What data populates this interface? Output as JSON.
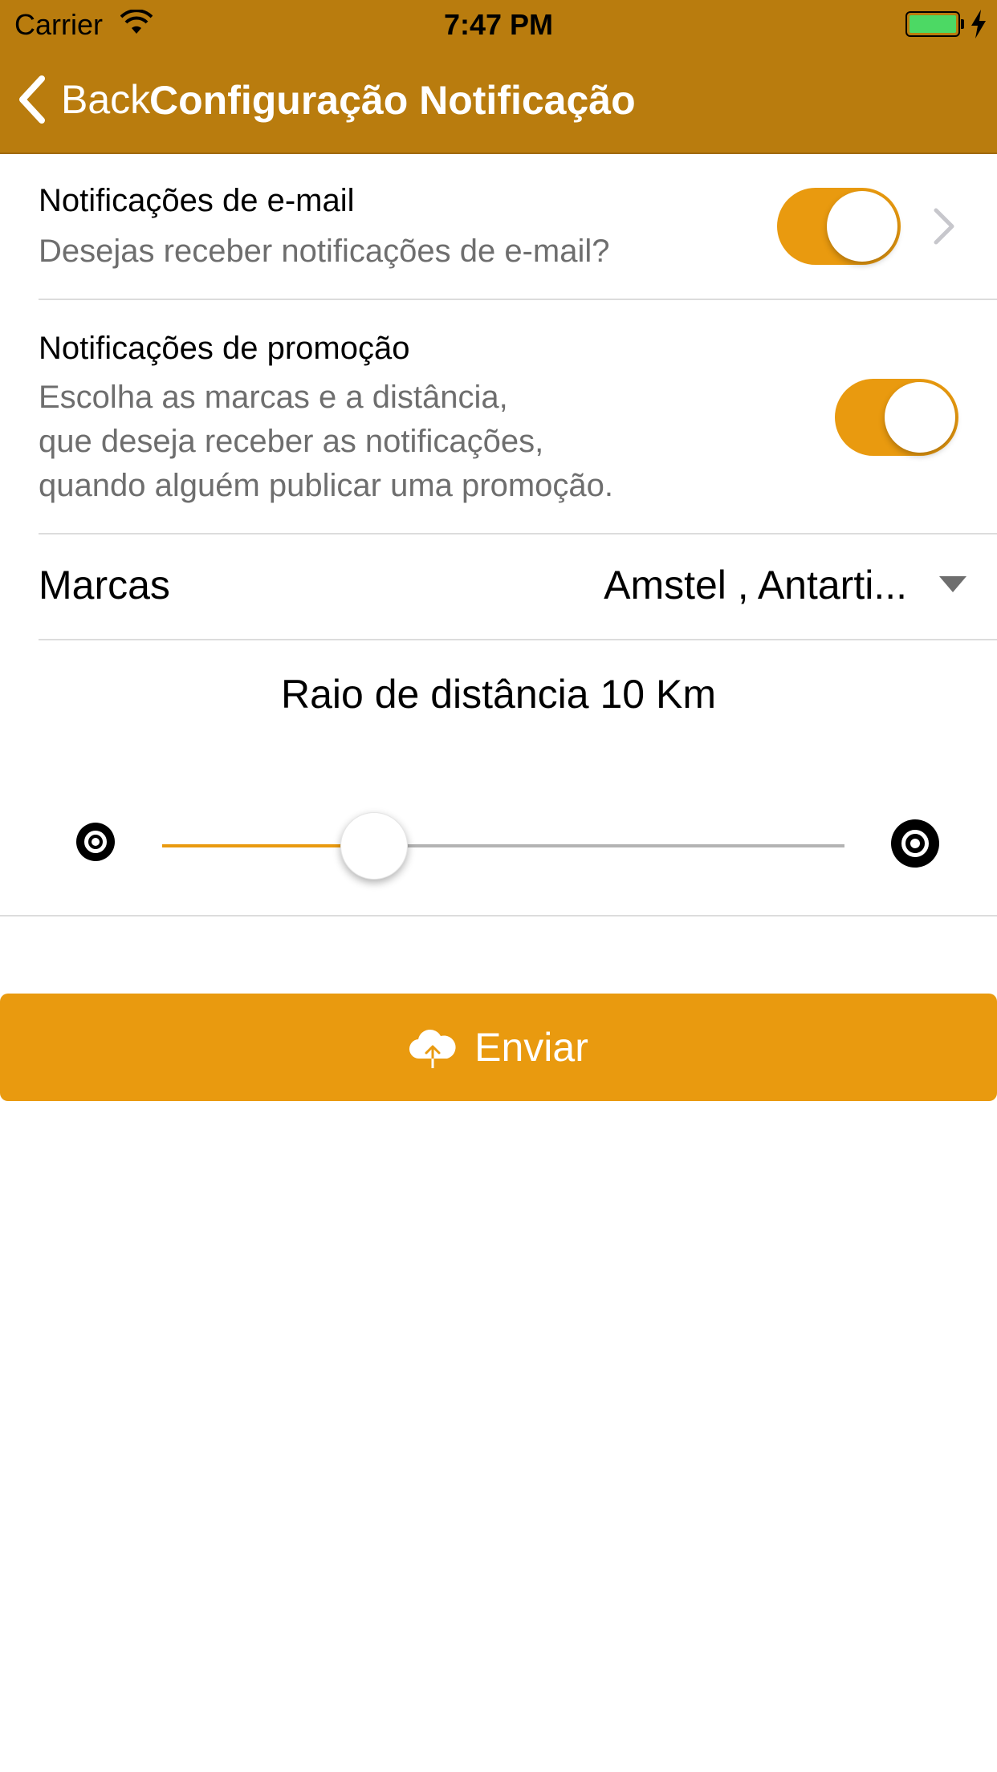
{
  "status_bar": {
    "carrier": "Carrier",
    "time": "7:47 PM",
    "battery_level": 1.0
  },
  "nav": {
    "back_label": "Back",
    "title": "Configuração Notificação"
  },
  "email_section": {
    "title": "Notificações de e-mail",
    "subtitle": "Desejas receber notificações de e-mail?",
    "enabled": true
  },
  "promo_section": {
    "title": "Notificações de promoção",
    "subtitle_lines": [
      "Escolha as marcas e a distância,",
      "que deseja receber as notificações,",
      "quando alguém publicar uma promoção."
    ],
    "enabled": true
  },
  "brands": {
    "label": "Marcas",
    "value": "Amstel , Antarti..."
  },
  "distance": {
    "label": "Raio de distância 10 Km",
    "slider_fraction": 0.31
  },
  "submit": {
    "label": "Enviar"
  },
  "colors": {
    "nav": "#b97c0e",
    "accent": "#e99a0f"
  },
  "icons": {
    "back": "chevron-left-icon",
    "disclosure": "chevron-right-icon",
    "dropdown": "caret-down-icon",
    "min": "target-icon",
    "max": "target-icon",
    "submit": "cloud-upload-icon"
  }
}
